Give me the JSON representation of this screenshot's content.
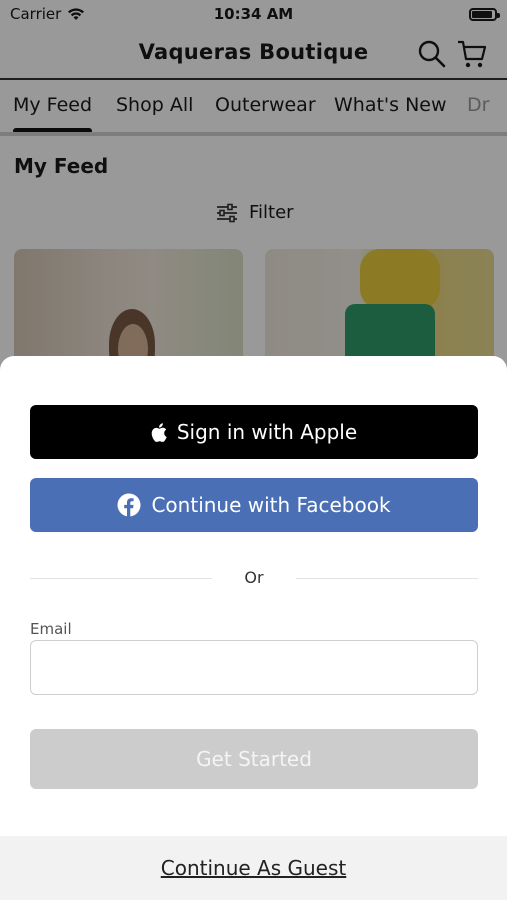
{
  "status_bar": {
    "carrier": "Carrier",
    "time": "10:34 AM",
    "battery_level": 0.8
  },
  "header": {
    "title": "Vaqueras Boutique",
    "icons": [
      "search-icon",
      "cart-icon"
    ]
  },
  "tabs": [
    {
      "label": "My Feed",
      "active": true
    },
    {
      "label": "Shop All",
      "active": false
    },
    {
      "label": "Outerwear",
      "active": false
    },
    {
      "label": "What's New",
      "active": false
    },
    {
      "label": "Dr",
      "active": false
    }
  ],
  "feed": {
    "heading": "My Feed",
    "filter_label": "Filter",
    "filter_icon": "sliders-icon"
  },
  "sheet": {
    "apple_button": "Sign in with Apple",
    "facebook_button": "Continue with Facebook",
    "or_text": "Or",
    "email_label": "Email",
    "email_value": "",
    "email_placeholder": "",
    "get_started_button": "Get Started",
    "guest_link": "Continue As Guest"
  },
  "colors": {
    "apple": "#000000",
    "facebook": "#4a6fb5",
    "disabled_button": "#cccccc",
    "overlay": "#000000"
  }
}
